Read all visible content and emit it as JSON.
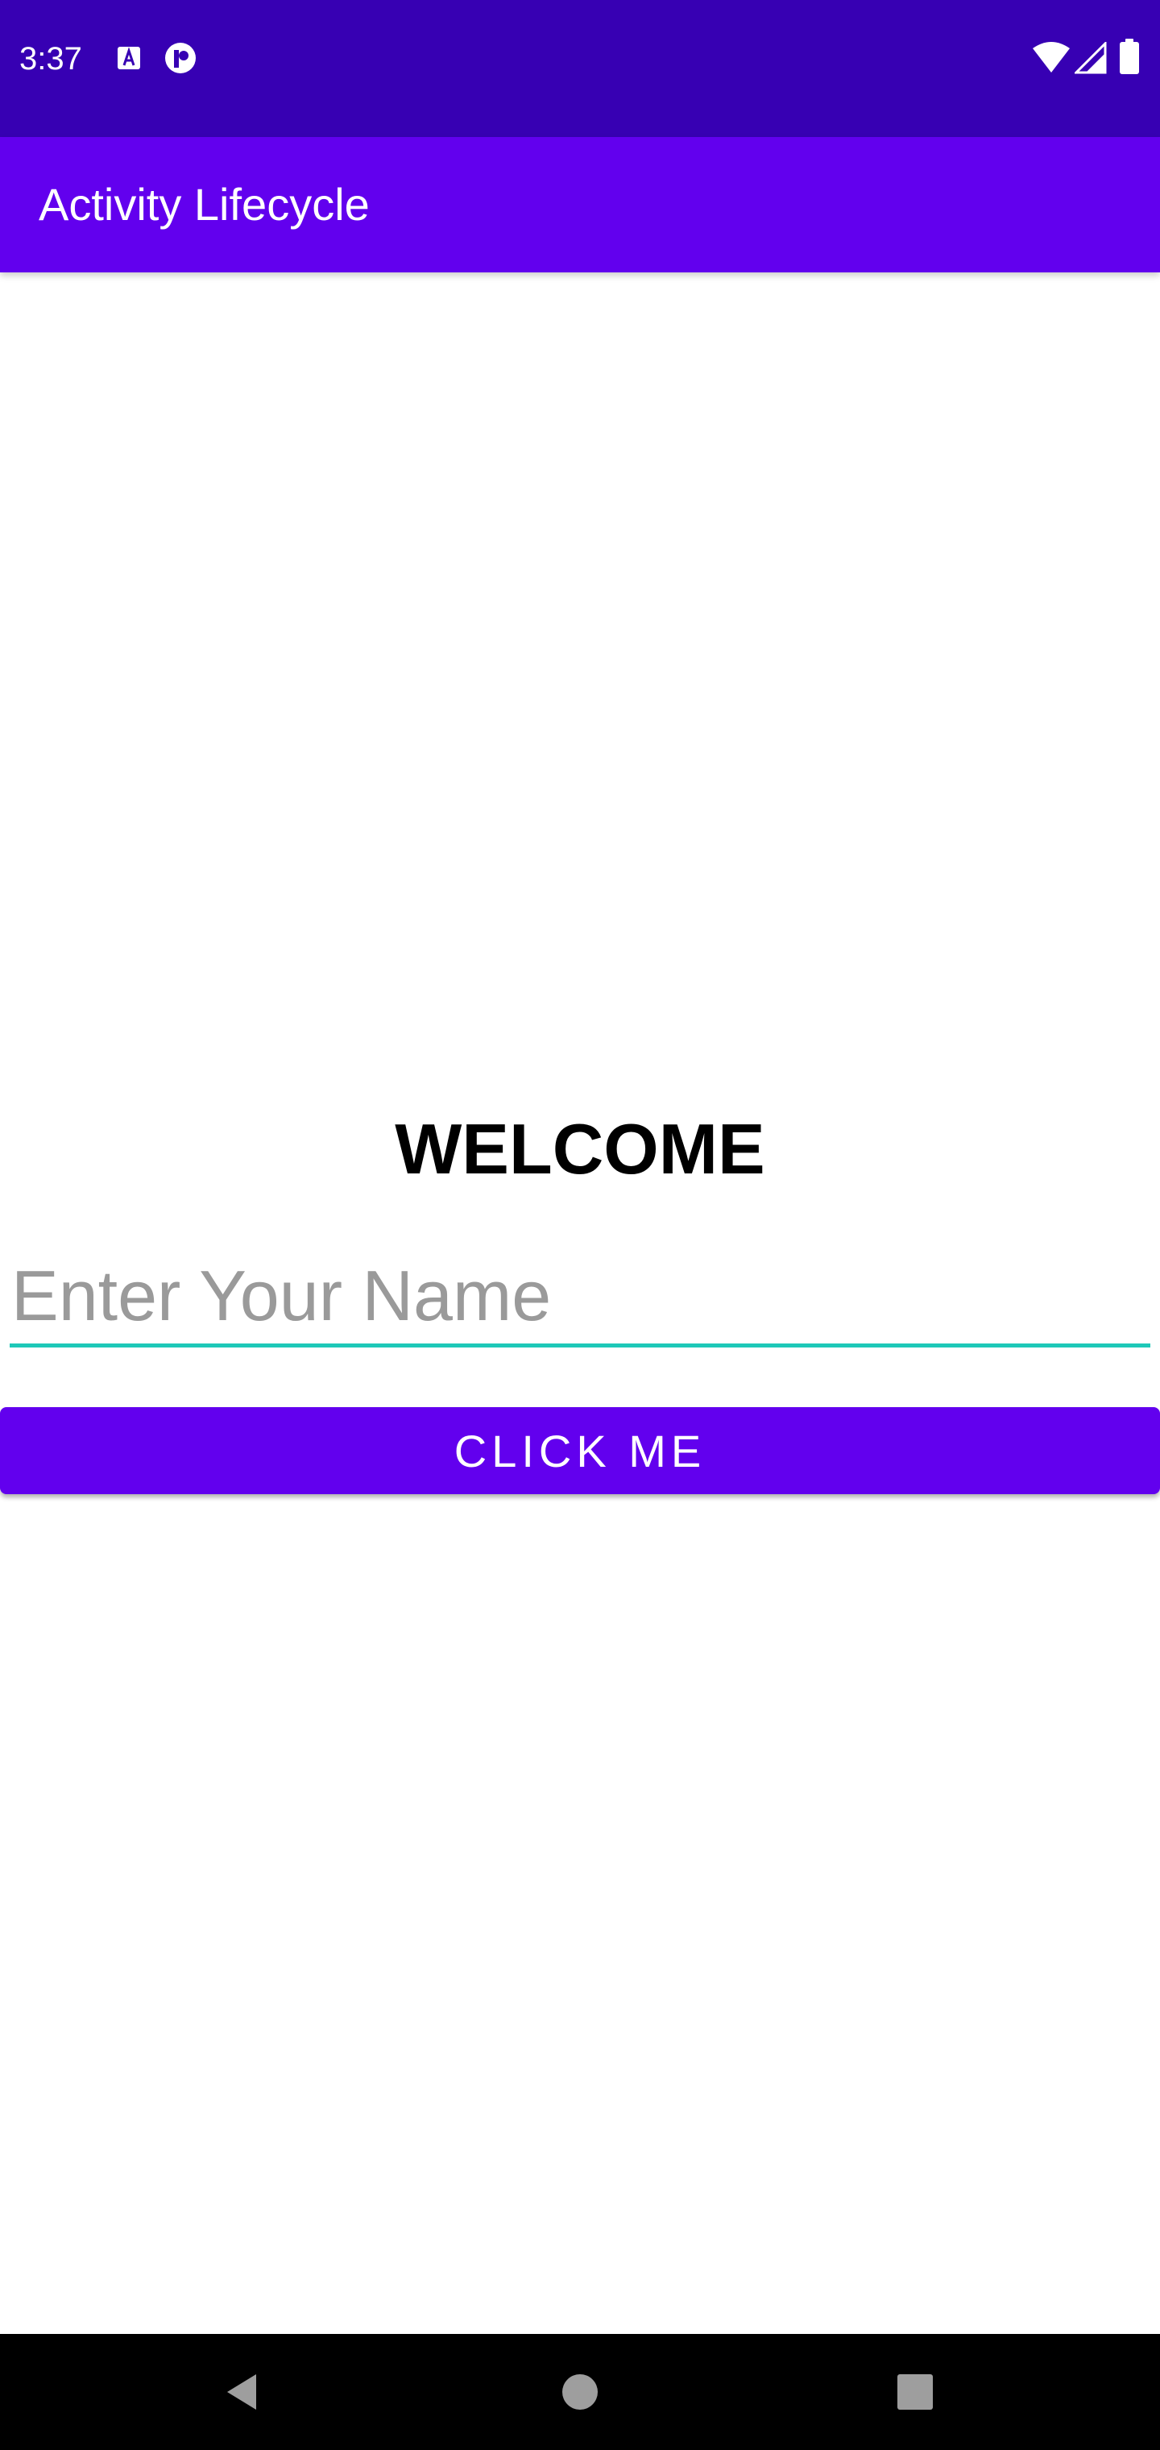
{
  "status_bar": {
    "time": "3:37",
    "background_color": "#3700b3",
    "notification_icons": [
      "font-a-icon",
      "p-circle-icon"
    ],
    "system_icons": [
      "wifi-icon",
      "cell-signal-icon",
      "battery-icon"
    ]
  },
  "app_bar": {
    "title": "Activity Lifecycle",
    "background_color": "#6200ee"
  },
  "main": {
    "heading": "WELCOME",
    "name_input": {
      "placeholder": "Enter Your Name",
      "value": "",
      "underline_color": "#1ec8b8"
    },
    "button": {
      "label": "CLICK ME",
      "background_color": "#6200ee"
    }
  },
  "nav_bar": {
    "buttons": [
      "back-icon",
      "home-icon",
      "recents-icon"
    ]
  }
}
